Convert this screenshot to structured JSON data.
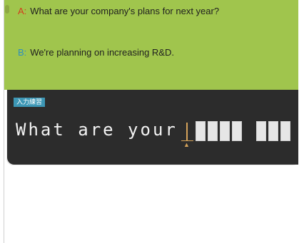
{
  "dialogue": {
    "speaker_a": "A:",
    "line_a": "What are your company's plans for next year?",
    "speaker_b": "B:",
    "line_b": "We're planning on increasing R&D."
  },
  "exercise": {
    "mode_tag": "入力練習",
    "typed_text": "What are your",
    "cursor_mark": "▲",
    "remaining_word_lengths": [
      4,
      3
    ]
  },
  "colors": {
    "green_panel": "#a0c54d",
    "dark_panel": "#2c2c2c",
    "speaker_a": "#d33b1c",
    "speaker_b": "#2f8fbe",
    "tag_bg": "#3d97b5",
    "cursor": "#d5a35a"
  }
}
